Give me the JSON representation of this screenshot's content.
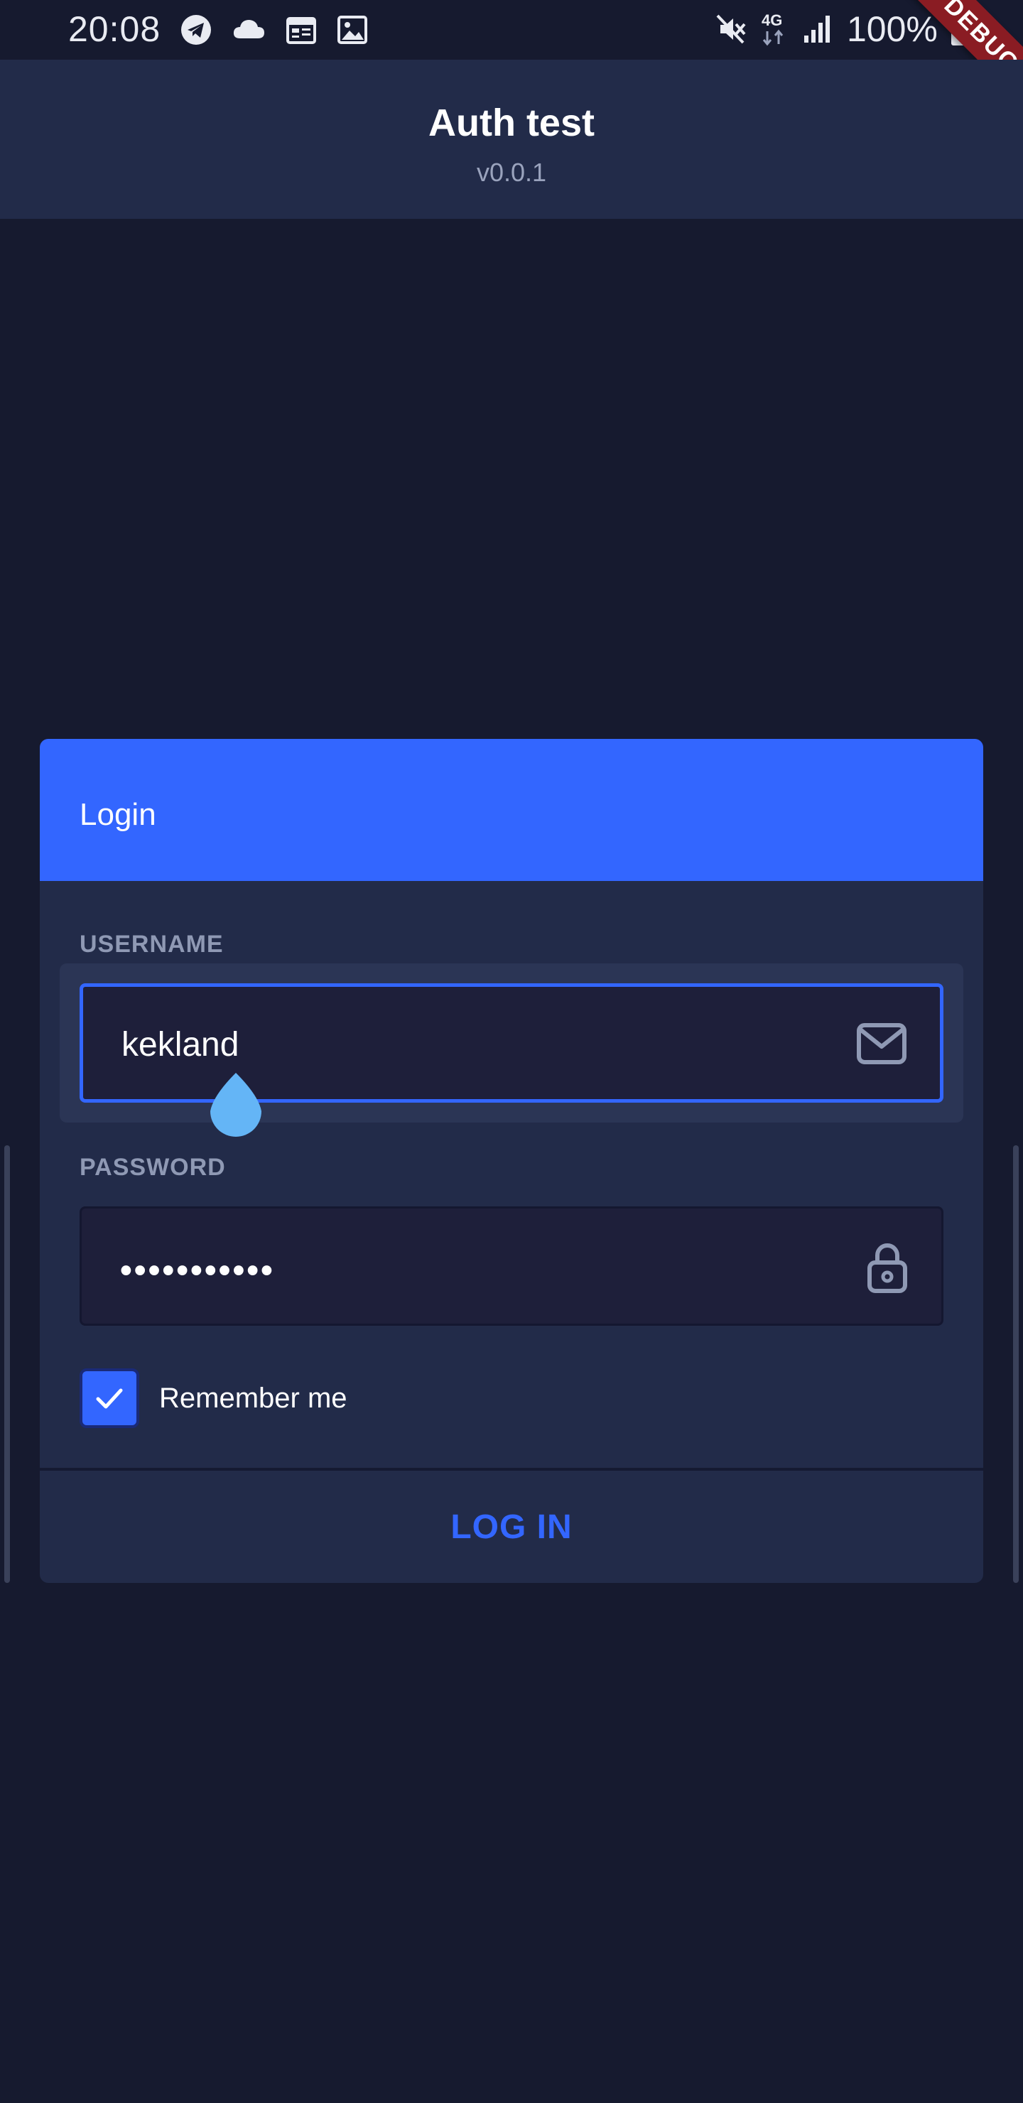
{
  "status_bar": {
    "time": "20:08",
    "battery_percent": "100%",
    "network_label": "4G",
    "left_icons": [
      "telegram-icon",
      "cloud-icon",
      "calendar-icon",
      "image-icon"
    ],
    "right_icons": [
      "mute-icon",
      "network-4g-icon",
      "signal-icon",
      "battery-icon"
    ]
  },
  "debug_banner": {
    "label": "DEBUG"
  },
  "app_bar": {
    "title": "Auth test",
    "subtitle": "v0.0.1"
  },
  "login_card": {
    "header_title": "Login",
    "username": {
      "label": "USERNAME",
      "value": "kekland",
      "icon": "mail-icon",
      "focused": true
    },
    "password": {
      "label": "PASSWORD",
      "value": "•••••••••••",
      "icon": "lock-icon"
    },
    "remember_me": {
      "label": "Remember me",
      "checked": true
    },
    "submit_label": "LOG IN"
  },
  "colors": {
    "background": "#161a2f",
    "app_bar": "#222b49",
    "card": "#222b49",
    "accent": "#3366ff",
    "input_fill": "#1e1f3a",
    "label_muted": "#8f99b4",
    "debug_ribbon": "#8a1c23",
    "cursor_handle": "#64b5f6"
  }
}
